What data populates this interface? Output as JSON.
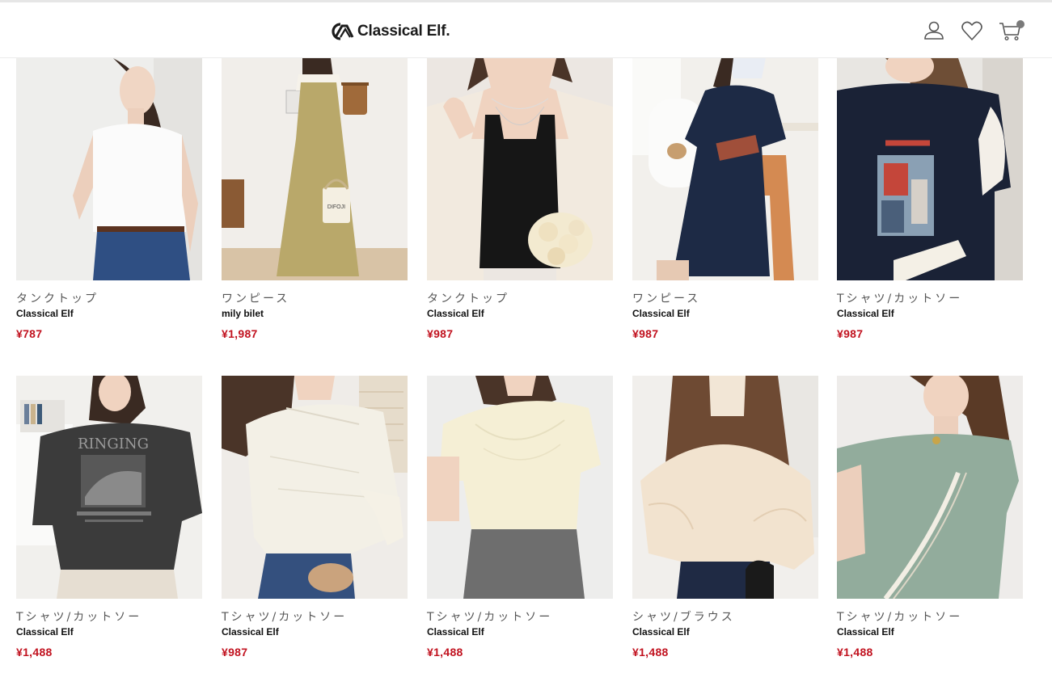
{
  "header": {
    "logo_text": "Classical Elf.",
    "account_icon": "user-icon",
    "favorites_icon": "heart-icon",
    "cart_icon": "cart-icon"
  },
  "colors": {
    "price": "#c1121f",
    "text_category": "#555555",
    "text_brand": "#111111"
  },
  "products": [
    {
      "category": "タンクトップ",
      "brand": "Classical Elf",
      "price": "¥787",
      "image": "white-tank-top-photo"
    },
    {
      "category": "ワンピース",
      "brand": "mily bilet",
      "price": "¥1,987",
      "image": "khaki-dress-photo"
    },
    {
      "category": "タンクトップ",
      "brand": "Classical Elf",
      "price": "¥987",
      "image": "black-tank-top-photo"
    },
    {
      "category": "ワンピース",
      "brand": "Classical Elf",
      "price": "¥987",
      "image": "navy-dress-photo"
    },
    {
      "category": "Tシャツ/カットソー",
      "brand": "Classical Elf",
      "price": "¥987",
      "image": "navy-print-tshirt-photo"
    },
    {
      "category": "Tシャツ/カットソー",
      "brand": "Classical Elf",
      "price": "¥1,488",
      "image": "charcoal-graphic-tshirt-photo"
    },
    {
      "category": "Tシャツ/カットソー",
      "brand": "Classical Elf",
      "price": "¥987",
      "image": "ivory-asymmetric-top-photo"
    },
    {
      "category": "Tシャツ/カットソー",
      "brand": "Classical Elf",
      "price": "¥1,488",
      "image": "cream-draped-top-photo"
    },
    {
      "category": "シャツ/ブラウス",
      "brand": "Classical Elf",
      "price": "¥1,488",
      "image": "sheer-blouse-photo"
    },
    {
      "category": "Tシャツ/カットソー",
      "brand": "Classical Elf",
      "price": "¥1,488",
      "image": "sage-tshirt-photo"
    }
  ]
}
